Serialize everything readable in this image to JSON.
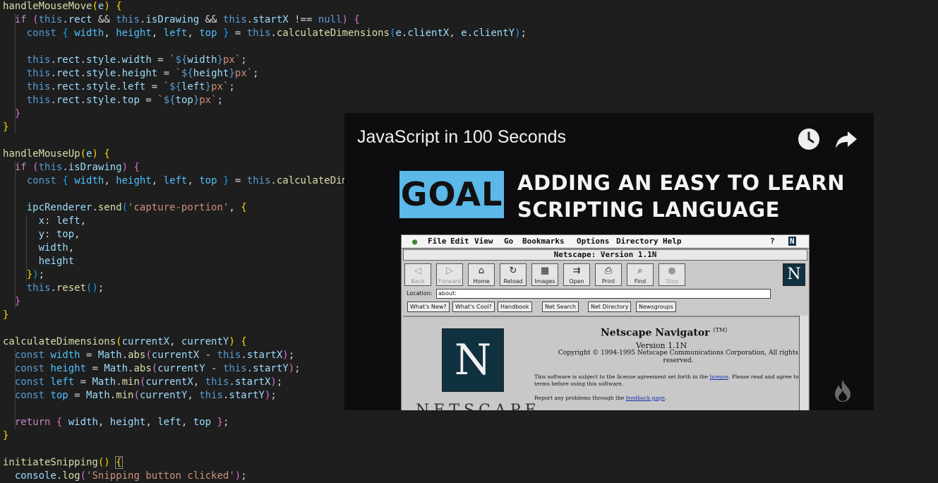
{
  "editor": {
    "lines": [
      [
        [
          "t-fn",
          "handleMouseMove"
        ],
        [
          "t-b1",
          "("
        ],
        [
          "t-var",
          "e"
        ],
        [
          "t-b1",
          ")"
        ],
        [
          "t-op",
          " "
        ],
        [
          "t-b1",
          "{"
        ]
      ],
      [
        [
          "t-op",
          "  "
        ],
        [
          "t-ctl",
          "if"
        ],
        [
          "t-op",
          " "
        ],
        [
          "t-b2",
          "("
        ],
        [
          "t-kw",
          "this"
        ],
        [
          "t-op",
          "."
        ],
        [
          "t-var",
          "rect"
        ],
        [
          "t-op",
          " && "
        ],
        [
          "t-kw",
          "this"
        ],
        [
          "t-op",
          "."
        ],
        [
          "t-var",
          "isDrawing"
        ],
        [
          "t-op",
          " && "
        ],
        [
          "t-kw",
          "this"
        ],
        [
          "t-op",
          "."
        ],
        [
          "t-var",
          "startX"
        ],
        [
          "t-op",
          " !== "
        ],
        [
          "t-kw",
          "null"
        ],
        [
          "t-b2",
          ")"
        ],
        [
          "t-op",
          " "
        ],
        [
          "t-b2",
          "{"
        ]
      ],
      [
        [
          "t-op",
          "    "
        ],
        [
          "t-kw",
          "const"
        ],
        [
          "t-op",
          " "
        ],
        [
          "t-b3",
          "{"
        ],
        [
          "t-op",
          " "
        ],
        [
          "t-cst",
          "width"
        ],
        [
          "t-op",
          ", "
        ],
        [
          "t-cst",
          "height"
        ],
        [
          "t-op",
          ", "
        ],
        [
          "t-cst",
          "left"
        ],
        [
          "t-op",
          ", "
        ],
        [
          "t-cst",
          "top"
        ],
        [
          "t-op",
          " "
        ],
        [
          "t-b3",
          "}"
        ],
        [
          "t-op",
          " = "
        ],
        [
          "t-kw",
          "this"
        ],
        [
          "t-op",
          "."
        ],
        [
          "t-fn",
          "calculateDimensions"
        ],
        [
          "t-b3",
          "("
        ],
        [
          "t-var",
          "e"
        ],
        [
          "t-op",
          "."
        ],
        [
          "t-var",
          "clientX"
        ],
        [
          "t-op",
          ", "
        ],
        [
          "t-var",
          "e"
        ],
        [
          "t-op",
          "."
        ],
        [
          "t-var",
          "clientY"
        ],
        [
          "t-b3",
          ")"
        ],
        [
          "t-op",
          ";"
        ]
      ],
      [],
      [
        [
          "t-op",
          "    "
        ],
        [
          "t-kw",
          "this"
        ],
        [
          "t-op",
          "."
        ],
        [
          "t-var",
          "rect"
        ],
        [
          "t-op",
          "."
        ],
        [
          "t-var",
          "style"
        ],
        [
          "t-op",
          "."
        ],
        [
          "t-var",
          "width"
        ],
        [
          "t-op",
          " = "
        ],
        [
          "t-str",
          "`"
        ],
        [
          "t-tpl",
          "${"
        ],
        [
          "t-var",
          "width"
        ],
        [
          "t-tpl",
          "}"
        ],
        [
          "t-str",
          "px`"
        ],
        [
          "t-op",
          ";"
        ]
      ],
      [
        [
          "t-op",
          "    "
        ],
        [
          "t-kw",
          "this"
        ],
        [
          "t-op",
          "."
        ],
        [
          "t-var",
          "rect"
        ],
        [
          "t-op",
          "."
        ],
        [
          "t-var",
          "style"
        ],
        [
          "t-op",
          "."
        ],
        [
          "t-var",
          "height"
        ],
        [
          "t-op",
          " = "
        ],
        [
          "t-str",
          "`"
        ],
        [
          "t-tpl",
          "${"
        ],
        [
          "t-var",
          "height"
        ],
        [
          "t-tpl",
          "}"
        ],
        [
          "t-str",
          "px`"
        ],
        [
          "t-op",
          ";"
        ]
      ],
      [
        [
          "t-op",
          "    "
        ],
        [
          "t-kw",
          "this"
        ],
        [
          "t-op",
          "."
        ],
        [
          "t-var",
          "rect"
        ],
        [
          "t-op",
          "."
        ],
        [
          "t-var",
          "style"
        ],
        [
          "t-op",
          "."
        ],
        [
          "t-var",
          "left"
        ],
        [
          "t-op",
          " = "
        ],
        [
          "t-str",
          "`"
        ],
        [
          "t-tpl",
          "${"
        ],
        [
          "t-var",
          "left"
        ],
        [
          "t-tpl",
          "}"
        ],
        [
          "t-str",
          "px`"
        ],
        [
          "t-op",
          ";"
        ]
      ],
      [
        [
          "t-op",
          "    "
        ],
        [
          "t-kw",
          "this"
        ],
        [
          "t-op",
          "."
        ],
        [
          "t-var",
          "rect"
        ],
        [
          "t-op",
          "."
        ],
        [
          "t-var",
          "style"
        ],
        [
          "t-op",
          "."
        ],
        [
          "t-var",
          "top"
        ],
        [
          "t-op",
          " = "
        ],
        [
          "t-str",
          "`"
        ],
        [
          "t-tpl",
          "${"
        ],
        [
          "t-var",
          "top"
        ],
        [
          "t-tpl",
          "}"
        ],
        [
          "t-str",
          "px`"
        ],
        [
          "t-op",
          ";"
        ]
      ],
      [
        [
          "t-op",
          "  "
        ],
        [
          "t-b2",
          "}"
        ]
      ],
      [
        [
          "t-b1",
          "}"
        ]
      ],
      [],
      [
        [
          "t-fn",
          "handleMouseUp"
        ],
        [
          "t-b1",
          "("
        ],
        [
          "t-var",
          "e"
        ],
        [
          "t-b1",
          ")"
        ],
        [
          "t-op",
          " "
        ],
        [
          "t-b1",
          "{"
        ]
      ],
      [
        [
          "t-op",
          "  "
        ],
        [
          "t-ctl",
          "if"
        ],
        [
          "t-op",
          " "
        ],
        [
          "t-b2",
          "("
        ],
        [
          "t-kw",
          "this"
        ],
        [
          "t-op",
          "."
        ],
        [
          "t-var",
          "isDrawing"
        ],
        [
          "t-b2",
          ")"
        ],
        [
          "t-op",
          " "
        ],
        [
          "t-b2",
          "{"
        ]
      ],
      [
        [
          "t-op",
          "    "
        ],
        [
          "t-kw",
          "const"
        ],
        [
          "t-op",
          " "
        ],
        [
          "t-b3",
          "{"
        ],
        [
          "t-op",
          " "
        ],
        [
          "t-cst",
          "width"
        ],
        [
          "t-op",
          ", "
        ],
        [
          "t-cst",
          "height"
        ],
        [
          "t-op",
          ", "
        ],
        [
          "t-cst",
          "left"
        ],
        [
          "t-op",
          ", "
        ],
        [
          "t-cst",
          "top"
        ],
        [
          "t-op",
          " "
        ],
        [
          "t-b3",
          "}"
        ],
        [
          "t-op",
          " = "
        ],
        [
          "t-kw",
          "this"
        ],
        [
          "t-op",
          "."
        ],
        [
          "t-fn",
          "calculateDimensions"
        ]
      ],
      [],
      [
        [
          "t-op",
          "    "
        ],
        [
          "t-var",
          "ipcRenderer"
        ],
        [
          "t-op",
          "."
        ],
        [
          "t-fn",
          "send"
        ],
        [
          "t-b3",
          "("
        ],
        [
          "t-str",
          "'capture-portion'"
        ],
        [
          "t-op",
          ", "
        ],
        [
          "t-b1",
          "{"
        ]
      ],
      [
        [
          "t-op",
          "      "
        ],
        [
          "t-var",
          "x"
        ],
        [
          "t-op",
          ": "
        ],
        [
          "t-var",
          "left"
        ],
        [
          "t-op",
          ","
        ]
      ],
      [
        [
          "t-op",
          "      "
        ],
        [
          "t-var",
          "y"
        ],
        [
          "t-op",
          ": "
        ],
        [
          "t-var",
          "top"
        ],
        [
          "t-op",
          ","
        ]
      ],
      [
        [
          "t-op",
          "      "
        ],
        [
          "t-var",
          "width"
        ],
        [
          "t-op",
          ","
        ]
      ],
      [
        [
          "t-op",
          "      "
        ],
        [
          "t-var",
          "height"
        ]
      ],
      [
        [
          "t-op",
          "    "
        ],
        [
          "t-b1",
          "}"
        ],
        [
          "t-b3",
          ")"
        ],
        [
          "t-op",
          ";"
        ]
      ],
      [
        [
          "t-op",
          "    "
        ],
        [
          "t-kw",
          "this"
        ],
        [
          "t-op",
          "."
        ],
        [
          "t-fn",
          "reset"
        ],
        [
          "t-b3",
          "()"
        ],
        [
          "t-op",
          ";"
        ]
      ],
      [
        [
          "t-op",
          "  "
        ],
        [
          "t-b2",
          "}"
        ]
      ],
      [
        [
          "t-b1",
          "}"
        ]
      ],
      [],
      [
        [
          "t-fn",
          "calculateDimensions"
        ],
        [
          "t-b1",
          "("
        ],
        [
          "t-var",
          "currentX"
        ],
        [
          "t-op",
          ", "
        ],
        [
          "t-var",
          "currentY"
        ],
        [
          "t-b1",
          ")"
        ],
        [
          "t-op",
          " "
        ],
        [
          "t-b1",
          "{"
        ]
      ],
      [
        [
          "t-op",
          "  "
        ],
        [
          "t-kw",
          "const"
        ],
        [
          "t-op",
          " "
        ],
        [
          "t-cst",
          "width"
        ],
        [
          "t-op",
          " = "
        ],
        [
          "t-var",
          "Math"
        ],
        [
          "t-op",
          "."
        ],
        [
          "t-fn",
          "abs"
        ],
        [
          "t-b2",
          "("
        ],
        [
          "t-var",
          "currentX"
        ],
        [
          "t-op",
          " - "
        ],
        [
          "t-kw",
          "this"
        ],
        [
          "t-op",
          "."
        ],
        [
          "t-var",
          "startX"
        ],
        [
          "t-b2",
          ")"
        ],
        [
          "t-op",
          ";"
        ]
      ],
      [
        [
          "t-op",
          "  "
        ],
        [
          "t-kw",
          "const"
        ],
        [
          "t-op",
          " "
        ],
        [
          "t-cst",
          "height"
        ],
        [
          "t-op",
          " = "
        ],
        [
          "t-var",
          "Math"
        ],
        [
          "t-op",
          "."
        ],
        [
          "t-fn",
          "abs"
        ],
        [
          "t-b2",
          "("
        ],
        [
          "t-var",
          "currentY"
        ],
        [
          "t-op",
          " - "
        ],
        [
          "t-kw",
          "this"
        ],
        [
          "t-op",
          "."
        ],
        [
          "t-var",
          "startY"
        ],
        [
          "t-b2",
          ")"
        ],
        [
          "t-op",
          ";"
        ]
      ],
      [
        [
          "t-op",
          "  "
        ],
        [
          "t-kw",
          "const"
        ],
        [
          "t-op",
          " "
        ],
        [
          "t-cst",
          "left"
        ],
        [
          "t-op",
          " = "
        ],
        [
          "t-var",
          "Math"
        ],
        [
          "t-op",
          "."
        ],
        [
          "t-fn",
          "min"
        ],
        [
          "t-b2",
          "("
        ],
        [
          "t-var",
          "currentX"
        ],
        [
          "t-op",
          ", "
        ],
        [
          "t-kw",
          "this"
        ],
        [
          "t-op",
          "."
        ],
        [
          "t-var",
          "startX"
        ],
        [
          "t-b2",
          ")"
        ],
        [
          "t-op",
          ";"
        ]
      ],
      [
        [
          "t-op",
          "  "
        ],
        [
          "t-kw",
          "const"
        ],
        [
          "t-op",
          " "
        ],
        [
          "t-cst",
          "top"
        ],
        [
          "t-op",
          " = "
        ],
        [
          "t-var",
          "Math"
        ],
        [
          "t-op",
          "."
        ],
        [
          "t-fn",
          "min"
        ],
        [
          "t-b2",
          "("
        ],
        [
          "t-var",
          "currentY"
        ],
        [
          "t-op",
          ", "
        ],
        [
          "t-kw",
          "this"
        ],
        [
          "t-op",
          "."
        ],
        [
          "t-var",
          "startY"
        ],
        [
          "t-b2",
          ")"
        ],
        [
          "t-op",
          ";"
        ]
      ],
      [],
      [
        [
          "t-op",
          "  "
        ],
        [
          "t-ctl",
          "return"
        ],
        [
          "t-op",
          " "
        ],
        [
          "t-b2",
          "{"
        ],
        [
          "t-op",
          " "
        ],
        [
          "t-var",
          "width"
        ],
        [
          "t-op",
          ", "
        ],
        [
          "t-var",
          "height"
        ],
        [
          "t-op",
          ", "
        ],
        [
          "t-var",
          "left"
        ],
        [
          "t-op",
          ", "
        ],
        [
          "t-var",
          "top"
        ],
        [
          "t-op",
          " "
        ],
        [
          "t-b2",
          "}"
        ],
        [
          "t-op",
          ";"
        ]
      ],
      [
        [
          "t-b1",
          "}"
        ]
      ],
      [],
      [
        [
          "t-fn",
          "initiateSnipping"
        ],
        [
          "t-b1",
          "()"
        ],
        [
          "t-op",
          " "
        ],
        [
          "t-b1 cursor-box",
          "{"
        ]
      ],
      [
        [
          "t-op",
          "  "
        ],
        [
          "t-var",
          "console"
        ],
        [
          "t-op",
          "."
        ],
        [
          "t-fn",
          "log"
        ],
        [
          "t-b2",
          "("
        ],
        [
          "t-str",
          "'Snipping button clicked'"
        ],
        [
          "t-b2",
          ")"
        ],
        [
          "t-op",
          ";"
        ]
      ]
    ]
  },
  "video": {
    "title": "JavaScript in 100 Seconds",
    "watch_later_icon": "clock-icon",
    "share_icon": "share-arrow-icon",
    "badge": "GOAL",
    "headline_line1": "ADDING AN EASY TO LEARN",
    "headline_line2": "SCRIPTING LANGUAGE",
    "brand_icon": "fireship-flame-icon"
  },
  "netscape": {
    "menu": [
      "File",
      "Edit",
      "View",
      "Go",
      "Bookmarks",
      "Options",
      "Directory",
      "Help"
    ],
    "window_title": "Netscape: Version 1.1N",
    "toolbar": [
      {
        "label": "Back",
        "icon": "◁",
        "dim": true
      },
      {
        "label": "Forward",
        "icon": "▷",
        "dim": true
      },
      {
        "label": "Home",
        "icon": "⌂",
        "dim": false
      },
      {
        "label": "Reload",
        "icon": "↻",
        "dim": false
      },
      {
        "label": "Images",
        "icon": "▦",
        "dim": false
      },
      {
        "label": "Open",
        "icon": "⇉",
        "dim": false
      },
      {
        "label": "Print",
        "icon": "⎙",
        "dim": false
      },
      {
        "label": "Find",
        "icon": "⌕",
        "dim": false
      },
      {
        "label": "Stop",
        "icon": "●",
        "dim": true
      }
    ],
    "location_label": "Location:",
    "location_value": "about:",
    "directory_buttons": [
      "What's New?",
      "What's Cool?",
      "Handbook",
      "Net Search",
      "Net Directory",
      "Newsgroups"
    ],
    "logo_letter": "N",
    "product_name": "Netscape Navigator",
    "trademark": "(TM)",
    "version": "Version 1.1N",
    "copyright": "Copyright © 1994-1995 Netscape Communications Corporation, All rights reserved.",
    "license_text": "This software is subject to the license agreement set forth in the",
    "license_link": "license",
    "license_text2": ". Please read and agree to all terms before using this software.",
    "report_text": "Report any problems through the",
    "report_link": "feedback page",
    "wordmark": "NETSCAPE"
  }
}
